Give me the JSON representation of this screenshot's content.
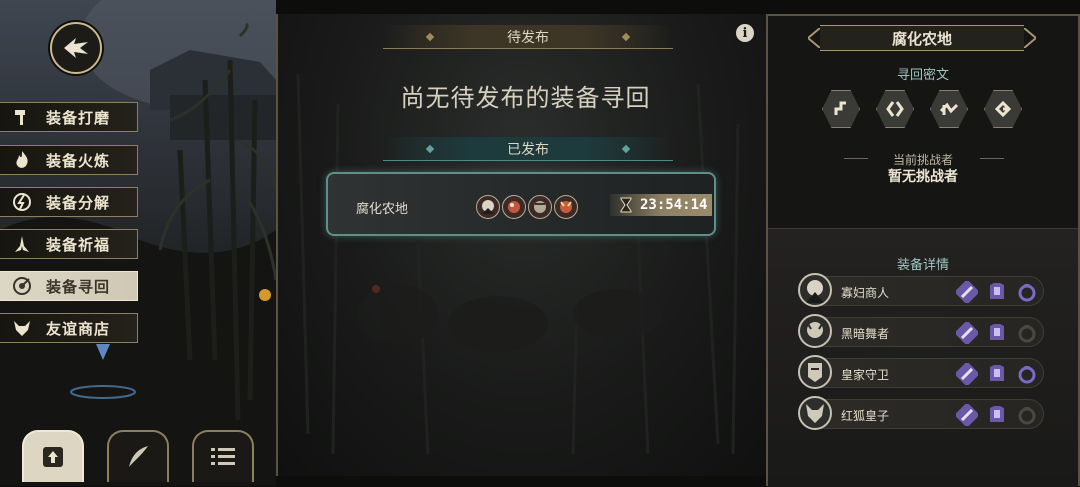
{
  "left_menu": {
    "items": [
      {
        "label": "装备打磨",
        "icon": "hammer-icon",
        "active": false
      },
      {
        "label": "装备火炼",
        "icon": "flame-icon",
        "active": false
      },
      {
        "label": "装备分解",
        "icon": "split-icon",
        "active": false
      },
      {
        "label": "装备祈福",
        "icon": "hands-icon",
        "active": false
      },
      {
        "label": "装备寻回",
        "icon": "target-icon",
        "active": true
      },
      {
        "label": "友谊商店",
        "icon": "fox-icon",
        "active": false
      }
    ],
    "bottom_buttons": [
      "upload-icon",
      "feather-icon",
      "list-icon"
    ]
  },
  "middle": {
    "pending_header": "待发布",
    "empty_message": "尚无待发布的装备寻回",
    "published_header": "已发布",
    "quest": {
      "name": "腐化农地",
      "timer": "23:54:14"
    }
  },
  "right": {
    "area_title": "腐化农地",
    "runes_label": "寻回密文",
    "challenger_label": "当前挑战者",
    "challenger_value": "暂无挑战者",
    "gear_label": "装备详情",
    "gear_rows": [
      {
        "name": "寡妇商人",
        "ring_active": true
      },
      {
        "name": "黑暗舞者",
        "ring_active": false
      },
      {
        "name": "皇家守卫",
        "ring_active": true
      },
      {
        "name": "红狐皇子",
        "ring_active": false
      }
    ]
  },
  "colors": {
    "gold": "#c9b98f",
    "teal": "#5f8f8b",
    "purple_slot": "#6a58a8",
    "panel_bg": "#151514"
  }
}
